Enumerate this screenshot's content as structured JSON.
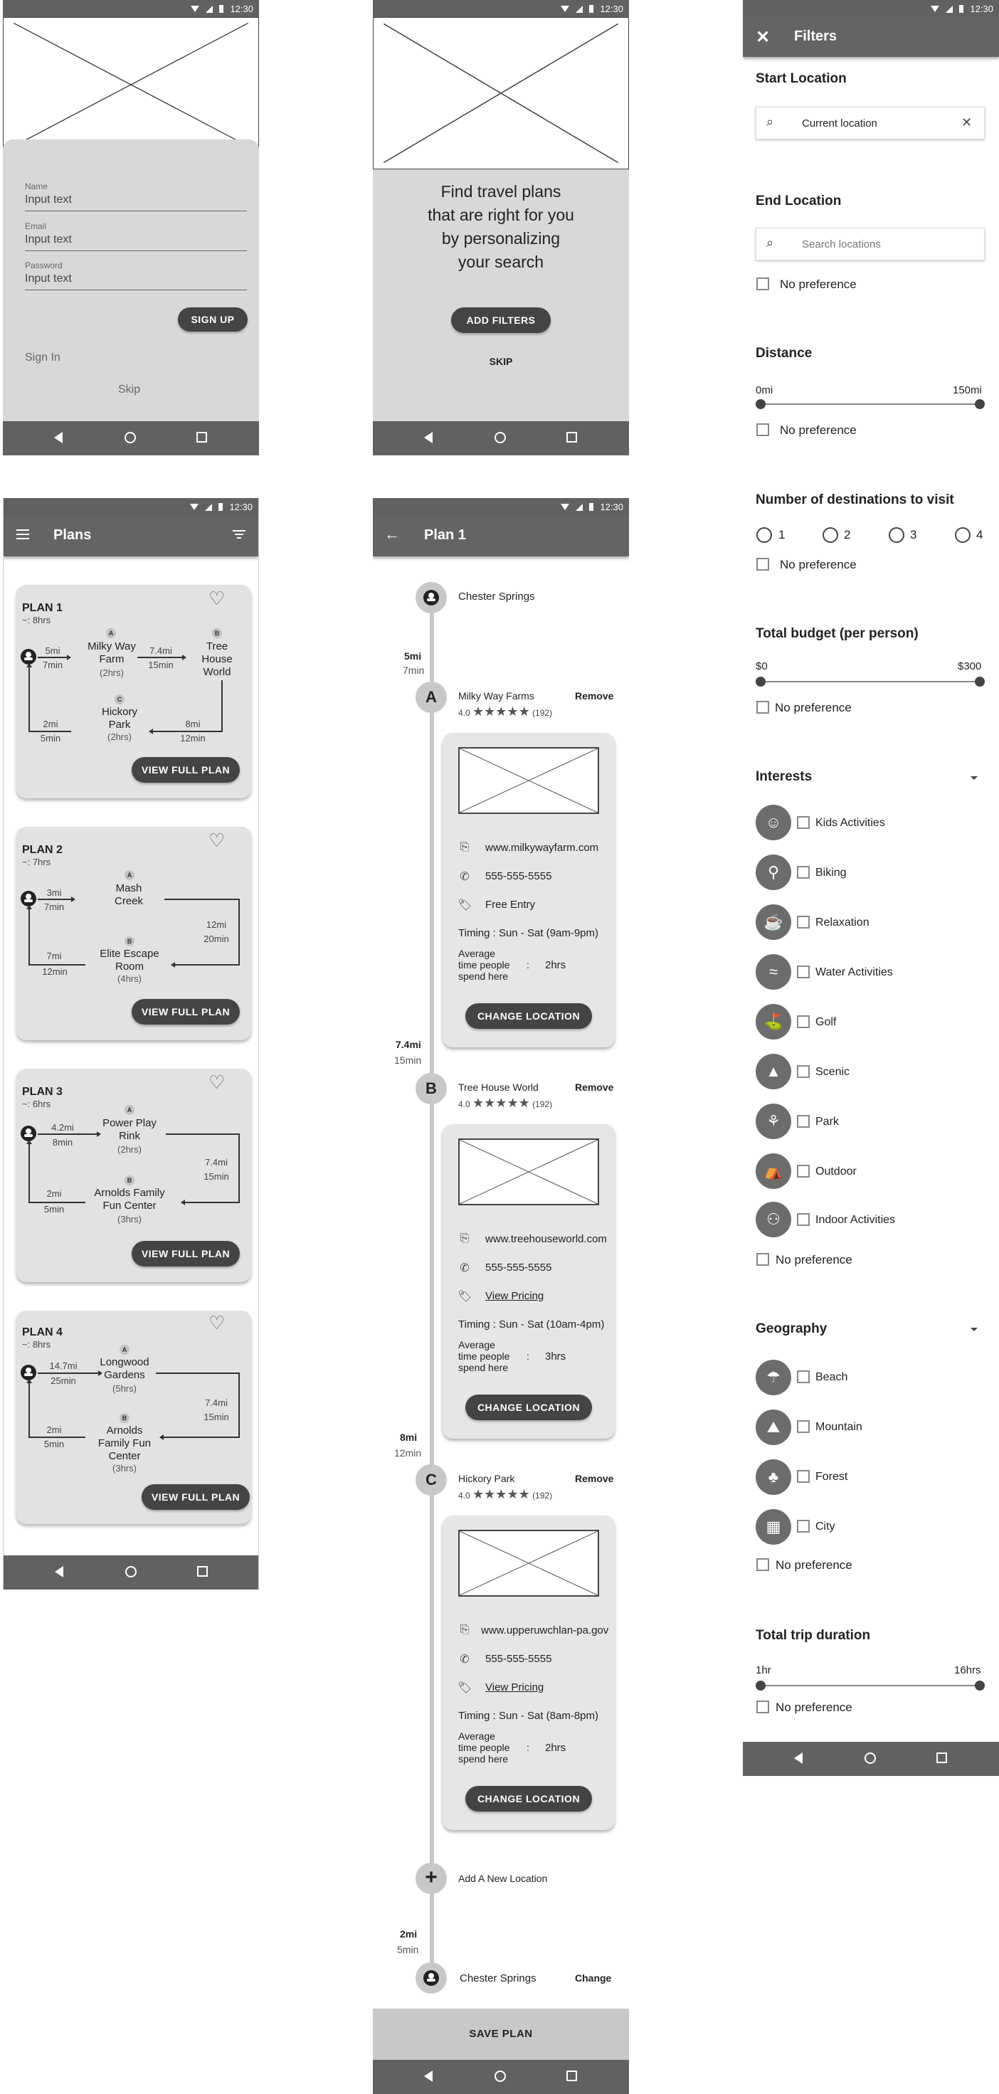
{
  "status": {
    "time": "12:30"
  },
  "signup": {
    "fields": [
      {
        "label": "Name",
        "placeholder": "Input text"
      },
      {
        "label": "Email",
        "placeholder": "Input text"
      },
      {
        "label": "Password",
        "placeholder": "Input text"
      }
    ],
    "signup_label": "SIGN UP",
    "signin_label": "Sign In",
    "skip_label": "Skip"
  },
  "intro": {
    "headline": [
      "Find travel plans",
      "that are right for you",
      "by personalizing",
      "your search"
    ],
    "add_filters_label": "ADD FILTERS",
    "skip_label": "SKIP"
  },
  "plans": {
    "title": "Plans",
    "view_label": "VIEW FULL PLAN",
    "list": [
      {
        "name": "PLAN 1",
        "duration": "~: 8hrs"
      },
      {
        "name": "PLAN 2",
        "duration": "~: 7hrs"
      },
      {
        "name": "PLAN 3",
        "duration": "~: 6hrs"
      },
      {
        "name": "PLAN 4",
        "duration": "~: 8hrs"
      }
    ],
    "p1": {
      "a_name": [
        "Milky Way",
        "Farm"
      ],
      "a_time": "(2hrs)",
      "b_name": [
        "Tree",
        "House",
        "World"
      ],
      "c_name": [
        "Hickory",
        "Park"
      ],
      "c_time": "(2hrs)",
      "leg1_d": "5mi",
      "leg1_t": "7min",
      "leg2_d": "7.4mi",
      "leg2_t": "15min",
      "leg3_d": "8mi",
      "leg3_t": "12min",
      "leg4_d": "2mi",
      "leg4_t": "5min"
    },
    "p2": {
      "a_name": [
        "Mash",
        "Creek"
      ],
      "b_name": [
        "Elite Escape",
        "Room"
      ],
      "b_time": "(4hrs)",
      "leg1_d": "3mi",
      "leg1_t": "7min",
      "leg2_d": "12mi",
      "leg2_t": "20min",
      "leg3_d": "7mi",
      "leg3_t": "12min"
    },
    "p3": {
      "a_name": [
        "Power Play",
        "Rink"
      ],
      "a_time": "(2hrs)",
      "b_name": [
        "Arnolds Family",
        "Fun Center"
      ],
      "b_time": "(3hrs)",
      "leg1_d": "4.2mi",
      "leg1_t": "8min",
      "leg2_d": "7.4mi",
      "leg2_t": "15min",
      "leg3_d": "2mi",
      "leg3_t": "5min"
    },
    "p4": {
      "a_name": [
        "Longwood",
        "Gardens"
      ],
      "a_time": "(5hrs)",
      "b_name": [
        "Arnolds",
        "Family Fun",
        "Center"
      ],
      "b_time": "(3hrs)",
      "leg1_d": "14.7mi",
      "leg1_t": "25min",
      "leg2_d": "7.4mi",
      "leg2_t": "15min",
      "leg3_d": "2mi",
      "leg3_t": "5min"
    },
    "letters": {
      "a": "A",
      "b": "B",
      "c": "C"
    }
  },
  "plan_detail": {
    "title": "Plan 1",
    "start": "Chester Springs",
    "remove_label": "Remove",
    "change_location_label": "CHANGE LOCATION",
    "avg_label": [
      "Average",
      "time people",
      "spend here"
    ],
    "colon": ":",
    "stops": [
      {
        "letter": "A",
        "name": "Milky Way Farms",
        "rating": "4.0",
        "reviews": "(192)",
        "leg_d": "5mi",
        "leg_t": "7min",
        "url": "www.milkywayfarm.com",
        "phone": "555-555-5555",
        "price": "Free Entry",
        "timing": "Timing : Sun - Sat (9am-9pm)",
        "avg": "2hrs"
      },
      {
        "letter": "B",
        "name": "Tree House World",
        "rating": "4.0",
        "reviews": "(192)",
        "leg_d": "7.4mi",
        "leg_t": "15min",
        "url": "www.treehouseworld.com",
        "phone": "555-555-5555",
        "price": "View Pricing",
        "timing": "Timing : Sun - Sat (10am-4pm)",
        "avg": "3hrs"
      },
      {
        "letter": "C",
        "name": "Hickory Park",
        "rating": "4.0",
        "reviews": "(192)",
        "leg_d": "8mi",
        "leg_t": "12min",
        "url": "www.upperuwchlan-pa.gov",
        "phone": "555-555-5555",
        "price": "View Pricing",
        "timing": "Timing : Sun - Sat (8am-8pm)",
        "avg": "2hrs"
      }
    ],
    "stars": "★★★★★",
    "add_location": "Add A New Location",
    "final_leg_d": "2mi",
    "final_leg_t": "5min",
    "end": "Chester Springs",
    "change_label": "Change",
    "save_label": "SAVE PLAN"
  },
  "filters": {
    "title": "Filters",
    "start_location": {
      "label": "Start Location",
      "value": "Current location"
    },
    "end_location": {
      "label": "End Location",
      "placeholder": "Search locations"
    },
    "no_pref": "No preference",
    "distance": {
      "label": "Distance",
      "min": "0mi",
      "max": "150mi"
    },
    "destinations": {
      "label": "Number of destinations to visit",
      "options": [
        "1",
        "2",
        "3",
        "4"
      ]
    },
    "budget": {
      "label": "Total budget (per person)",
      "min": "$0",
      "max": "$300"
    },
    "interests": {
      "label": "Interests",
      "items": [
        "Kids Activities",
        "Biking",
        "Relaxation",
        "Water Activities",
        "Golf",
        "Scenic",
        "Park",
        "Outdoor",
        "Indoor Activities"
      ]
    },
    "geography": {
      "label": "Geography",
      "items": [
        "Beach",
        "Mountain",
        "Forest",
        "City"
      ]
    },
    "duration": {
      "label": "Total trip duration",
      "min": "1hr",
      "max": "16hrs"
    }
  }
}
